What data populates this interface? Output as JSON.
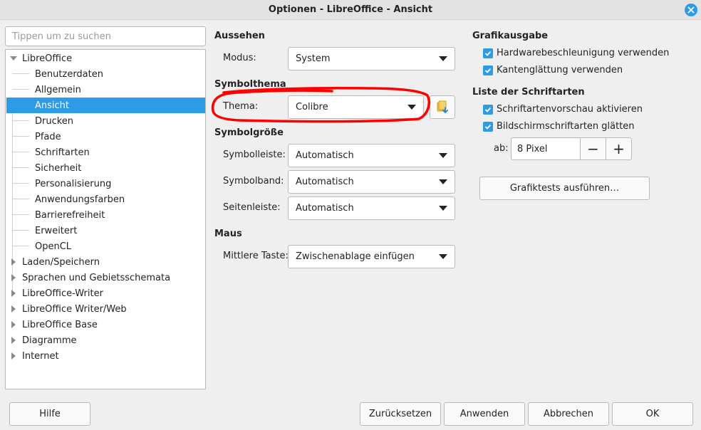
{
  "window": {
    "title": "Optionen - LibreOffice - Ansicht"
  },
  "search": {
    "placeholder": "Tippen um zu suchen"
  },
  "tree": {
    "root": "LibreOffice",
    "children": [
      "Benutzerdaten",
      "Allgemein",
      "Ansicht",
      "Drucken",
      "Pfade",
      "Schriftarten",
      "Sicherheit",
      "Personalisierung",
      "Anwendungsfarben",
      "Barrierefreiheit",
      "Erweitert",
      "OpenCL"
    ],
    "selected": "Ansicht",
    "collapsed": [
      "Laden/Speichern",
      "Sprachen und Gebietsschemata",
      "LibreOffice-Writer",
      "LibreOffice Writer/Web",
      "LibreOffice Base",
      "Diagramme",
      "Internet"
    ]
  },
  "aussehen": {
    "heading": "Aussehen",
    "modus_label": "Modus:",
    "modus_value": "System"
  },
  "symbolthema": {
    "heading": "Symbolthema",
    "thema_label": "Thema:",
    "thema_value": "Colibre",
    "add_icon": "add-theme-icon"
  },
  "symbolgroesse": {
    "heading": "Symbolgröße",
    "symbolleiste_label": "Symbolleiste:",
    "symbolleiste_value": "Automatisch",
    "symbolband_label": "Symbolband:",
    "symbolband_value": "Automatisch",
    "seitenleiste_label": "Seitenleiste:",
    "seitenleiste_value": "Automatisch"
  },
  "maus": {
    "heading": "Maus",
    "mittlere_label": "Mittlere Taste:",
    "mittlere_value": "Zwischenablage einfügen"
  },
  "grafikausgabe": {
    "heading": "Grafikausgabe",
    "hw_label": "Hardwarebeschleunigung verwenden",
    "hw_checked": true,
    "aa_label": "Kantenglättung verwenden",
    "aa_checked": true
  },
  "schriftarten": {
    "heading": "Liste der Schriftarten",
    "preview_label": "Schriftartenvorschau aktivieren",
    "preview_checked": true,
    "smooth_label": "Bildschirmschriftarten glätten",
    "smooth_checked": true,
    "ab_label": "ab:",
    "ab_value": "8 Pixel",
    "minus": "−",
    "plus": "+"
  },
  "grafiktests_label": "Grafiktests ausführen…",
  "buttons": {
    "hilfe": "Hilfe",
    "zuruecksetzen": "Zurücksetzen",
    "anwenden": "Anwenden",
    "abbrechen": "Abbrechen",
    "ok": "OK"
  },
  "colors": {
    "accent": "#2d9be6",
    "annotation": "#ff0000"
  }
}
